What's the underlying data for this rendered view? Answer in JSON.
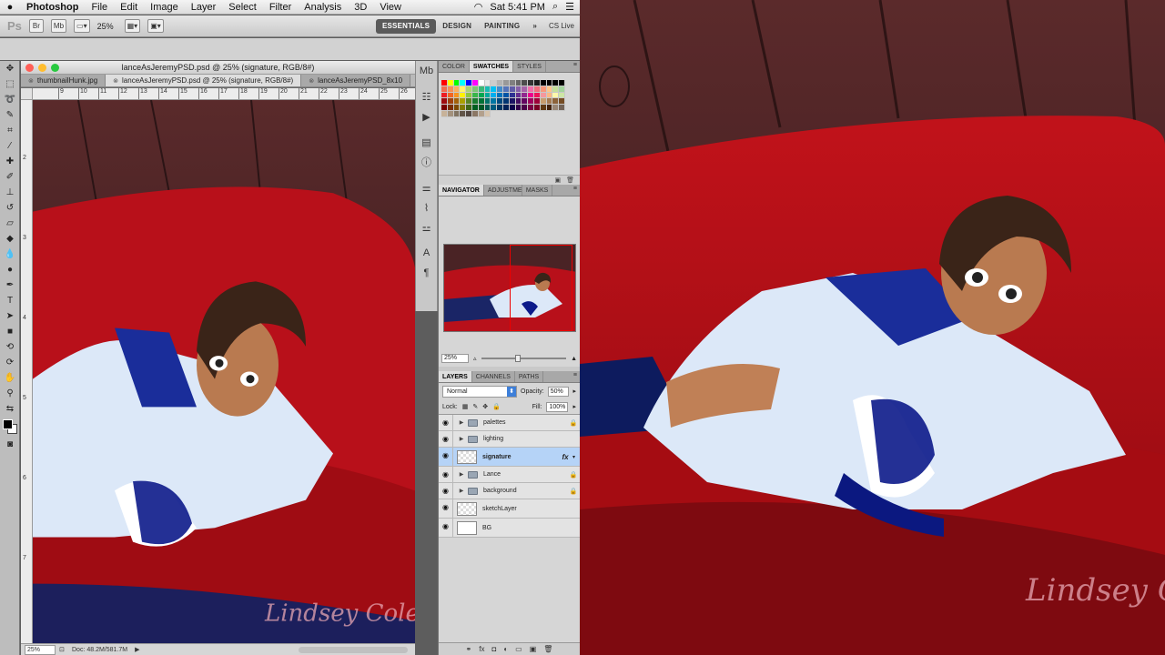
{
  "menubar": {
    "app_name": "Photoshop",
    "items": [
      "File",
      "Edit",
      "Image",
      "Layer",
      "Select",
      "Filter",
      "Analysis",
      "3D",
      "View"
    ],
    "clock": "Sat 5:41 PM"
  },
  "appbar": {
    "logo": "Ps",
    "bridge_label": "Br",
    "minibridge_label": "Mb",
    "zoom": "25%",
    "workspaces": [
      "ESSENTIALS",
      "DESIGN",
      "PAINTING"
    ],
    "more": "»",
    "cs_live": "CS Live"
  },
  "document": {
    "window_title": "lanceAsJeremyPSD.psd @ 25% (signature, RGB/8#)",
    "tabs": [
      {
        "label": "thumbnailHunk.jpg"
      },
      {
        "label": "lanceAsJeremyPSD.psd @ 25% (signature, RGB/8#)"
      },
      {
        "label": "lanceAsJeremyPSD_8x10"
      }
    ],
    "ruler_h_labels": [
      "9",
      "10",
      "11",
      "12",
      "13",
      "14",
      "15",
      "16",
      "17",
      "18",
      "19",
      "20",
      "21",
      "22",
      "23",
      "24",
      "25",
      "26",
      "27"
    ],
    "ruler_v_labels": [
      "2",
      "3",
      "4",
      "5",
      "6",
      "7"
    ],
    "status_zoom": "25%",
    "status_doc": "Doc: 48.2M/581.7M"
  },
  "swatches_panel": {
    "tabs": [
      "COLOR",
      "SWATCHES",
      "STYLES"
    ],
    "colors": [
      "#ff0000",
      "#ffff00",
      "#00ff00",
      "#00ffff",
      "#0000ff",
      "#ff00ff",
      "#ffffff",
      "#e6e6e6",
      "#cccccc",
      "#b3b3b3",
      "#999999",
      "#808080",
      "#666666",
      "#4d4d4d",
      "#333333",
      "#1a1a1a",
      "#000000",
      "#000000",
      "#000000",
      "#000000",
      "#f26c4f",
      "#f68e56",
      "#fbaf5d",
      "#fff568",
      "#acd372",
      "#7cc576",
      "#3bb878",
      "#1abbb4",
      "#00bff3",
      "#438cca",
      "#5574b9",
      "#605ca8",
      "#855fa8",
      "#a763a8",
      "#f06ea9",
      "#f26d7d",
      "#f7977a",
      "#fdc68a",
      "#c4df9b",
      "#a2d39c",
      "#ed1c24",
      "#f26522",
      "#f7941d",
      "#fff200",
      "#8dc63f",
      "#39b54a",
      "#00a651",
      "#00a99d",
      "#00aeef",
      "#0072bc",
      "#0054a6",
      "#2e3192",
      "#662d91",
      "#92278f",
      "#ec008c",
      "#ed145b",
      "#f5989d",
      "#fbb884",
      "#fdf8aa",
      "#cde6a5",
      "#9e0b0f",
      "#a0410d",
      "#a3620a",
      "#aba000",
      "#598527",
      "#197b30",
      "#007236",
      "#00746b",
      "#0076a3",
      "#004a80",
      "#003471",
      "#1b1464",
      "#440e62",
      "#630460",
      "#9e005d",
      "#9e0039",
      "#c69c6d",
      "#a67c52",
      "#8c6239",
      "#754c24",
      "#790000",
      "#7b2e00",
      "#7d4900",
      "#827b00",
      "#406618",
      "#005e20",
      "#005826",
      "#005952",
      "#005b7f",
      "#003663",
      "#002157",
      "#0d004c",
      "#32004b",
      "#4b0049",
      "#7b0046",
      "#7a0026",
      "#603913",
      "#42210b",
      "#998675",
      "#736357",
      "#c7b299",
      "#a3917c",
      "#827462",
      "#625548",
      "#534741",
      "#8b7765",
      "#b3a08c",
      "#d6c4ae"
    ]
  },
  "navigator_panel": {
    "tabs": [
      "NAVIGATOR",
      "ADJUSTMENTS",
      "MASKS"
    ],
    "zoom": "25%"
  },
  "layers_panel": {
    "tabs": [
      "LAYERS",
      "CHANNELS",
      "PATHS"
    ],
    "blend_mode": "Normal",
    "opacity_label": "Opacity:",
    "opacity": "50%",
    "lock_label": "Lock:",
    "fill_label": "Fill:",
    "fill": "100%",
    "layers": [
      {
        "name": "palettes",
        "type": "group",
        "locked": true
      },
      {
        "name": "lighting",
        "type": "group",
        "locked": false
      },
      {
        "name": "signature",
        "type": "layer",
        "selected": true,
        "fx": "fx"
      },
      {
        "name": "Lance",
        "type": "group",
        "locked": true
      },
      {
        "name": "background",
        "type": "group",
        "locked": true
      },
      {
        "name": "sketchLayer",
        "type": "layer"
      },
      {
        "name": "BG",
        "type": "layer",
        "plain": true
      }
    ]
  },
  "artwork": {
    "signature_text": "Lindsey Cole"
  }
}
